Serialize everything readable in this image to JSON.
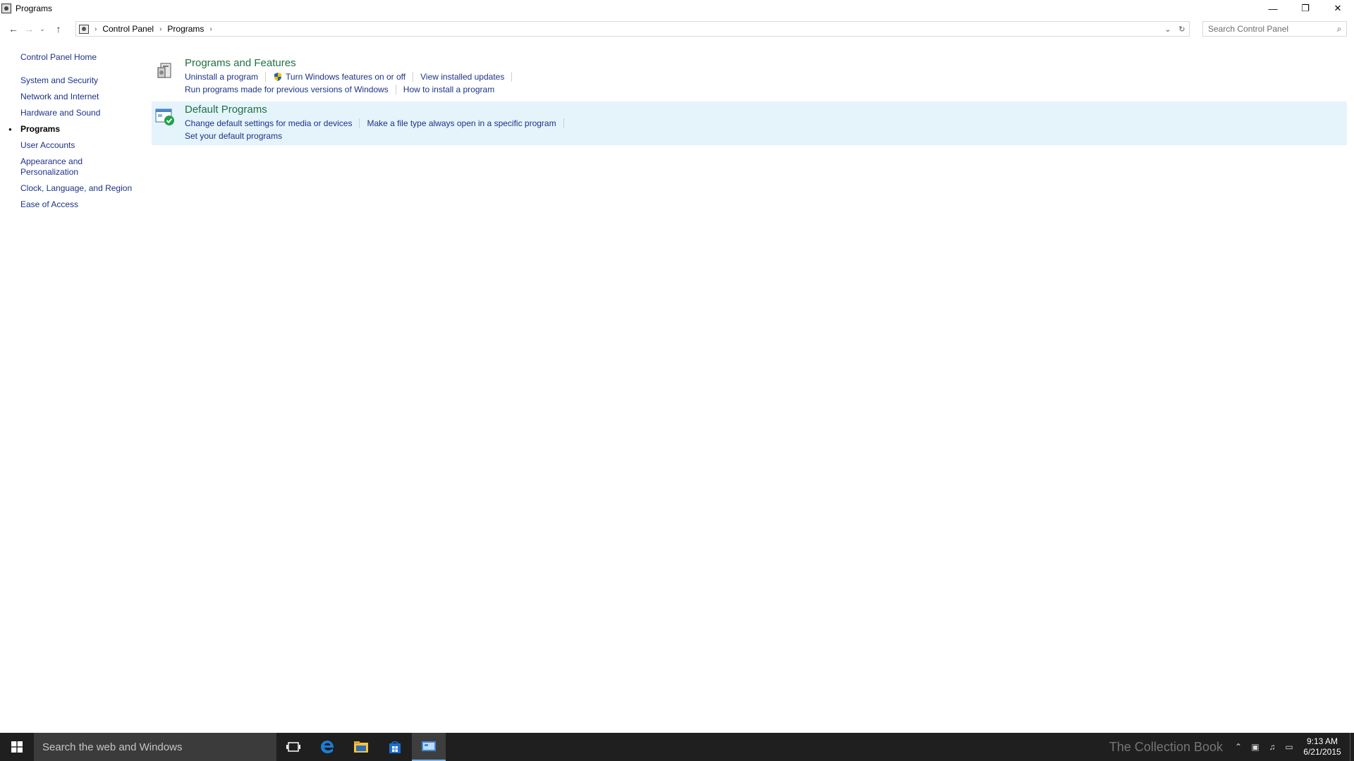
{
  "window": {
    "title": "Programs",
    "minimize_glyph": "—",
    "restore_glyph": "❐",
    "close_glyph": "✕"
  },
  "nav": {
    "back_glyph": "←",
    "forward_glyph": "→",
    "recent_glyph": "⌵",
    "up_glyph": "↑"
  },
  "breadcrumb": {
    "items": [
      "Control Panel",
      "Programs"
    ],
    "separator": "›"
  },
  "search": {
    "placeholder": "Search Control Panel"
  },
  "sidebar": {
    "home": "Control Panel Home",
    "items": [
      {
        "label": "System and Security",
        "active": false
      },
      {
        "label": "Network and Internet",
        "active": false
      },
      {
        "label": "Hardware and Sound",
        "active": false
      },
      {
        "label": "Programs",
        "active": true
      },
      {
        "label": "User Accounts",
        "active": false
      },
      {
        "label": "Appearance and Personalization",
        "active": false
      },
      {
        "label": "Clock, Language, and Region",
        "active": false
      },
      {
        "label": "Ease of Access",
        "active": false
      }
    ]
  },
  "categories": [
    {
      "title": "Programs and Features",
      "icon": "programs-features-icon",
      "links_row1": [
        "Uninstall a program",
        "Turn Windows features on or off",
        "View installed updates"
      ],
      "links_row2": [
        "Run programs made for previous versions of Windows",
        "How to install a program"
      ]
    },
    {
      "title": "Default Programs",
      "icon": "default-programs-icon",
      "links_row1": [
        "Change default settings for media or devices",
        "Make a file type always open in a specific program"
      ],
      "links_row2": [
        "Set your default programs"
      ]
    }
  ],
  "taskbar": {
    "search_placeholder": "Search the web and Windows",
    "watermark": "The Collection Book",
    "time": "9:13 AM",
    "date": "6/21/2015"
  },
  "colors": {
    "link": "#1e3287",
    "category_title": "#1e7145",
    "hover_bg": "#e5f3fb",
    "taskbar": "#1f1f1f",
    "taskbar_accent": "#7ab4ea"
  }
}
